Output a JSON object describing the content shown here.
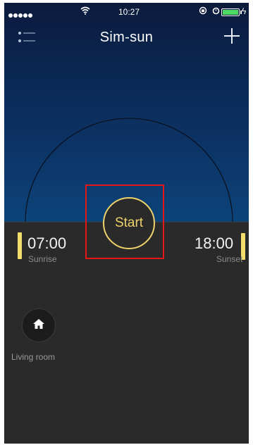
{
  "status_bar": {
    "time": "10:27",
    "signal_icon": "signal-dots-icon",
    "wifi_icon": "wifi-icon",
    "lock_icon": "orientation-lock-icon",
    "alarm_icon": "alarm-icon",
    "battery_icon": "battery-icon",
    "charging_icon": "charging-bolt-icon",
    "battery_level": 1.0
  },
  "header": {
    "title": "Sim-sun",
    "menu_icon": "list-menu-icon",
    "add_icon": "plus-icon"
  },
  "schedule": {
    "sunrise_time": "07:00",
    "sunrise_label": "Sunrise",
    "sunset_time": "18:00",
    "sunset_label": "Sunset",
    "start_label": "Start"
  },
  "rooms": [
    {
      "label": "Living room",
      "icon": "home-icon"
    }
  ],
  "colors": {
    "accent": "#eed26a",
    "sky_top": "#0b1b3c",
    "sky_bottom": "#0c4479",
    "background": "#2b2a2a",
    "highlight": "#e61616"
  }
}
